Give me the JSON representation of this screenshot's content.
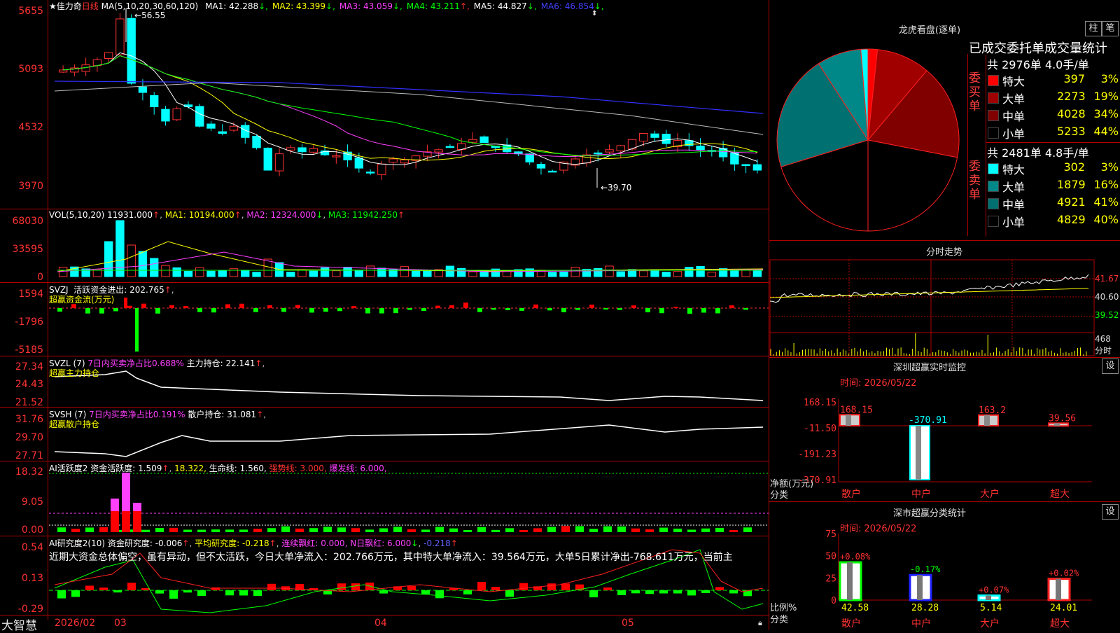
{
  "stock": {
    "name": "佳力奇",
    "period": "日线"
  },
  "main_chart": {
    "ma_params": "MA(5,10,20,30,60,120)",
    "ma": [
      {
        "label": "MA1: 42.288",
        "arrow": "↓",
        "color": "#ffffff"
      },
      {
        "label": "MA2: 43.399",
        "arrow": "↓",
        "color": "#ffff00"
      },
      {
        "label": "MA3: 43.059",
        "arrow": "↓",
        "color": "#ff40ff"
      },
      {
        "label": "MA4: 43.211",
        "arrow": "↑",
        "color": "#00ff00"
      },
      {
        "label": "MA5: 44.827",
        "arrow": "↓",
        "color": "#ffffff"
      },
      {
        "label": "MA6: 46.854",
        "arrow": "↓",
        "color": "#4040ff"
      }
    ],
    "y_ticks": [
      "5655",
      "5093",
      "4532",
      "3970"
    ],
    "high_label": "56.55",
    "low_label": "39.70"
  },
  "vol_chart": {
    "title": "VOL(5,10,20)",
    "value": "11931.000",
    "ma1": "MA1: 10194.000",
    "ma2": "MA2: 12324.000",
    "ma3": "MA3: 11942.250",
    "y_ticks": [
      "68030",
      "33595",
      "0"
    ]
  },
  "svzj": {
    "title": "SVZJ",
    "label": "活跃资金进出: 202.765",
    "sub": "超赢资金流(万元)",
    "y_ticks": [
      "1594",
      "-1796",
      "-5185"
    ]
  },
  "svzl": {
    "title": "SVZL (7)",
    "ratio": "7日内买卖净占比0.688%",
    "label": "主力持仓: 22.141",
    "sub": "超赢主力持仓",
    "y_ticks": [
      "27.34",
      "24.43",
      "21.52"
    ]
  },
  "svsh": {
    "title": "SVSH (7)",
    "ratio": "7日内买卖净占比0.191%",
    "label": "散户持仓: 31.081",
    "sub": "超赢散户持仓",
    "y_ticks": [
      "31.76",
      "29.70",
      "27.71"
    ]
  },
  "ai_active": {
    "title": "AI活跃度2",
    "label": "资金活跃度: 1.509",
    "v2": "18.322,",
    "life": "生命线: 1.560,",
    "strong": "强势线: 3.000,",
    "burst": "爆发线: 6.000,",
    "y_ticks": [
      "18.32",
      "9.05",
      "0.00"
    ]
  },
  "ai_research": {
    "title": "AI研究度2(10)",
    "label": "资金研究度: -0.006",
    "avg": "平均研究度: -0.218",
    "streak": "连续飘红: 0.000,",
    "nday": "N日飘红: 6.000",
    "last": "-0.218",
    "comment": "近期大资金总体偏空，虽有异动，但不太活跃，今日大单净流入：202.766万元，其中特大单净流入：39.564万元，大单5日累计净出-768.611万元，当前主",
    "y_ticks": [
      "0.54",
      "0.13",
      "-0.29"
    ]
  },
  "x_axis": {
    "brand": "大智慧",
    "labels": [
      "2026/02",
      "03",
      "04",
      "05"
    ]
  },
  "lhb": {
    "title": "龙虎看盘(逐单)",
    "btn1": "柱",
    "btn2": "笔",
    "subtitle": "已成交委托单成交量统计",
    "buy": {
      "side": "委买单",
      "summary": "共 2976单 4.0手/单",
      "rows": [
        {
          "name": "特大",
          "value": "397",
          "pct": "3%",
          "color": "#ff0000"
        },
        {
          "name": "大单",
          "value": "2273",
          "pct": "19%",
          "color": "#a00000"
        },
        {
          "name": "中单",
          "value": "4028",
          "pct": "34%",
          "color": "#800000"
        },
        {
          "name": "小单",
          "value": "5233",
          "pct": "44%",
          "color": "#000000"
        }
      ]
    },
    "sell": {
      "side": "委卖单",
      "summary": "共 2481单 4.8手/单",
      "rows": [
        {
          "name": "特大",
          "value": "302",
          "pct": "3%",
          "color": "#00ffff"
        },
        {
          "name": "大单",
          "value": "1879",
          "pct": "16%",
          "color": "#008888"
        },
        {
          "name": "中单",
          "value": "4921",
          "pct": "41%",
          "color": "#007070"
        },
        {
          "name": "小单",
          "value": "4829",
          "pct": "40%",
          "color": "#000000"
        }
      ]
    }
  },
  "intraday": {
    "title": "分时走势",
    "y_ticks": [
      "41.67",
      "40.60",
      "39.52"
    ],
    "vol_tick": "468",
    "vol_unit": "分时"
  },
  "sz_monitor": {
    "title": "深圳超赢实时监控",
    "btn": "设",
    "time": "时间: 2026/05/22",
    "y_ticks": [
      "168.15",
      "-11.50",
      "-191.23",
      "-370.91"
    ],
    "bars": [
      {
        "cat": "散户",
        "label": "168.15",
        "value": 168.15
      },
      {
        "cat": "中户",
        "label": "-370.91",
        "value": -370.91
      },
      {
        "cat": "大户",
        "label": "163.2",
        "value": 163.2
      },
      {
        "cat": "超大",
        "label": "39.56",
        "value": 39.56
      }
    ],
    "ylabel": "净额(万元)",
    "xlabel": "分类"
  },
  "sz_class": {
    "title": "深市超赢分类统计",
    "btn": "设",
    "time": "时间: 2026/05/22",
    "y_ticks": [
      "75",
      "50",
      "25",
      "0"
    ],
    "bars": [
      {
        "cat": "散户",
        "top": "+0.08%",
        "bottom": "42.58",
        "value": 42.58
      },
      {
        "cat": "中户",
        "top": "-0.17%",
        "bottom": "28.28",
        "value": 28.28
      },
      {
        "cat": "大户",
        "top": "+0.07%",
        "bottom": "5.14",
        "value": 5.14
      },
      {
        "cat": "超大",
        "top": "+0.02%",
        "bottom": "24.01",
        "value": 24.01
      }
    ],
    "ylabel": "比例%",
    "xlabel": "分类"
  }
}
